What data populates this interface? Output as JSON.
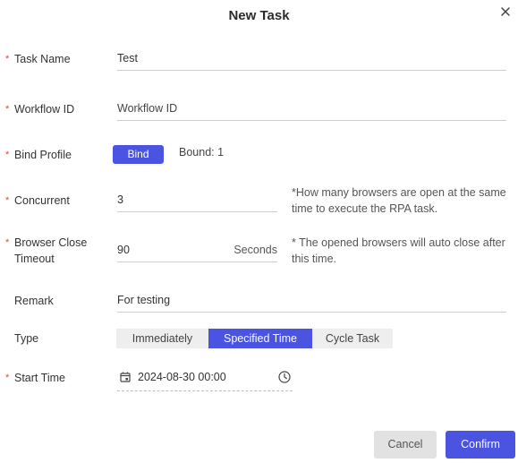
{
  "dialog": {
    "title": "New Task",
    "close_icon": "close-icon"
  },
  "form": {
    "required_mark": "*",
    "task_name": {
      "label": "Task Name",
      "value": "Test"
    },
    "workflow_id": {
      "label": "Workflow ID",
      "placeholder": "Workflow ID",
      "value": ""
    },
    "bind_profile": {
      "label": "Bind Profile",
      "button": "Bind",
      "bound": "Bound: 1"
    },
    "concurrent": {
      "label": "Concurrent",
      "value": "3",
      "hint": "*How many browsers are open at the same time to execute the RPA task."
    },
    "browser_close_timeout": {
      "label": "Browser Close Timeout",
      "value": "90",
      "unit": "Seconds",
      "hint": "* The opened browsers will auto close after this time."
    },
    "remark": {
      "label": "Remark",
      "value": "For testing"
    },
    "type": {
      "label": "Type",
      "options": [
        "Immediately",
        "Specified Time",
        "Cycle Task"
      ],
      "selected": "Specified Time"
    },
    "start_time": {
      "label": "Start Time",
      "value": "2024-08-30 00:00",
      "calendar_icon": "calendar-icon",
      "clock_icon": "clock-icon"
    }
  },
  "footer": {
    "cancel": "Cancel",
    "confirm": "Confirm"
  },
  "colors": {
    "accent": "#4a54e1",
    "required": "#e8443a"
  }
}
